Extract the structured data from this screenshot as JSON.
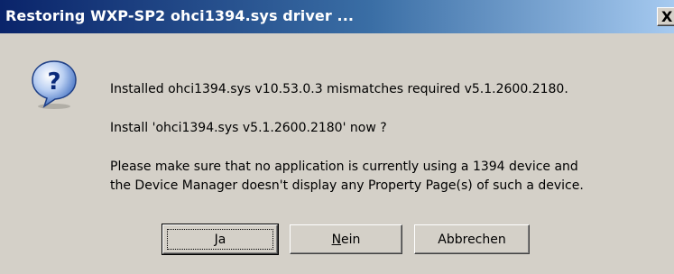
{
  "window": {
    "title": "Restoring WXP-SP2 ohci1394.sys driver ...",
    "close_label": "X"
  },
  "dialog": {
    "icon": "question-icon",
    "message_line1": "Installed ohci1394.sys v10.53.0.3 mismatches required v5.1.2600.2180.",
    "message_line2": "Install 'ohci1394.sys v5.1.2600.2180' now ?",
    "message_line3a": "Please make sure that no application is currently using a 1394 device and",
    "message_line3b": "the Device Manager doesn't display any Property Page(s) of such a device."
  },
  "buttons": {
    "yes_mnemonic": "J",
    "yes_rest": "a",
    "no_mnemonic": "N",
    "no_rest": "ein",
    "cancel": "Abbrechen"
  },
  "colors": {
    "titlebar_start": "#0a246a",
    "titlebar_end": "#a6caf0",
    "dialog_bg": "#d4d0c8"
  }
}
